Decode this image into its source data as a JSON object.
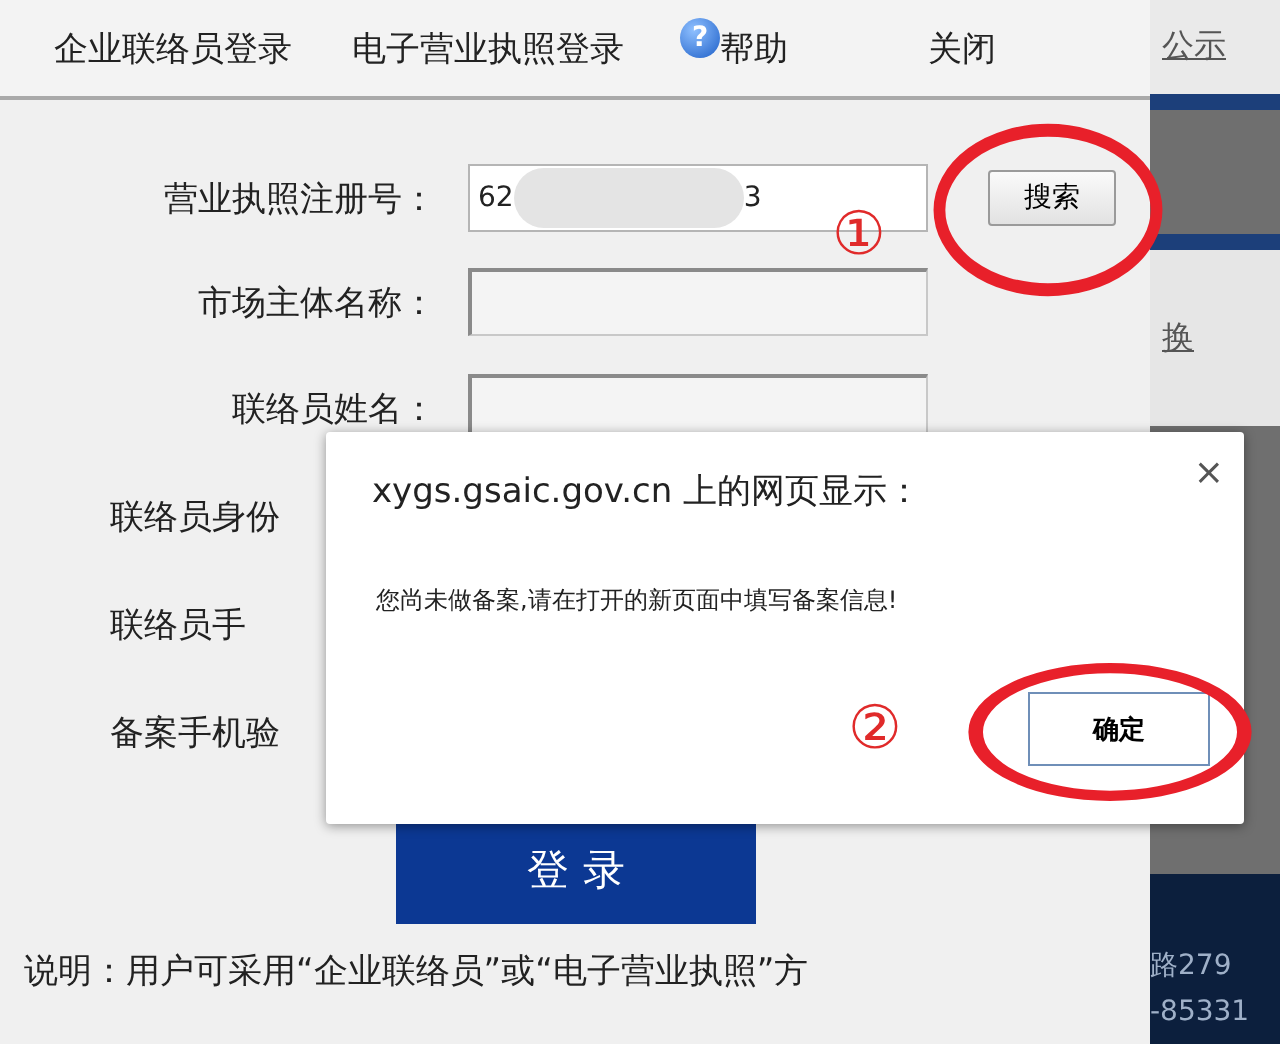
{
  "nav": {
    "items": [
      {
        "label": "企业联络员登录",
        "kind": "link"
      },
      {
        "label": "电子营业执照登录",
        "kind": "link"
      },
      {
        "label": "帮助",
        "kind": "help",
        "glyph": "?"
      },
      {
        "label": "关闭",
        "kind": "close"
      }
    ]
  },
  "form": {
    "rows": [
      {
        "label": "营业执照注册号：",
        "kind": "search",
        "value_start": "62",
        "value_end": "3",
        "button": "搜索"
      },
      {
        "label": "市场主体名称：",
        "kind": "field"
      },
      {
        "label": "联络员姓名：",
        "kind": "field"
      },
      {
        "label": "联络员身份",
        "kind": "cut"
      },
      {
        "label": "联络员手",
        "kind": "cut"
      },
      {
        "label": "备案手机验",
        "kind": "cut"
      }
    ],
    "submit": "登 录",
    "note": "说明：用户可采用“企业联络员”或“电子营业执照”方"
  },
  "dialog": {
    "title": "xygs.gsaic.gov.cn 上的网页显示：",
    "close": "×",
    "message": "您尚未做备案,请在打开的新页面中填写备案信息!",
    "button": "确定"
  },
  "annotations": [
    {
      "label": "①"
    },
    {
      "label": "②"
    }
  ],
  "background_page": {
    "texts": [
      "公示",
      "换",
      "路279",
      "-85331"
    ]
  }
}
